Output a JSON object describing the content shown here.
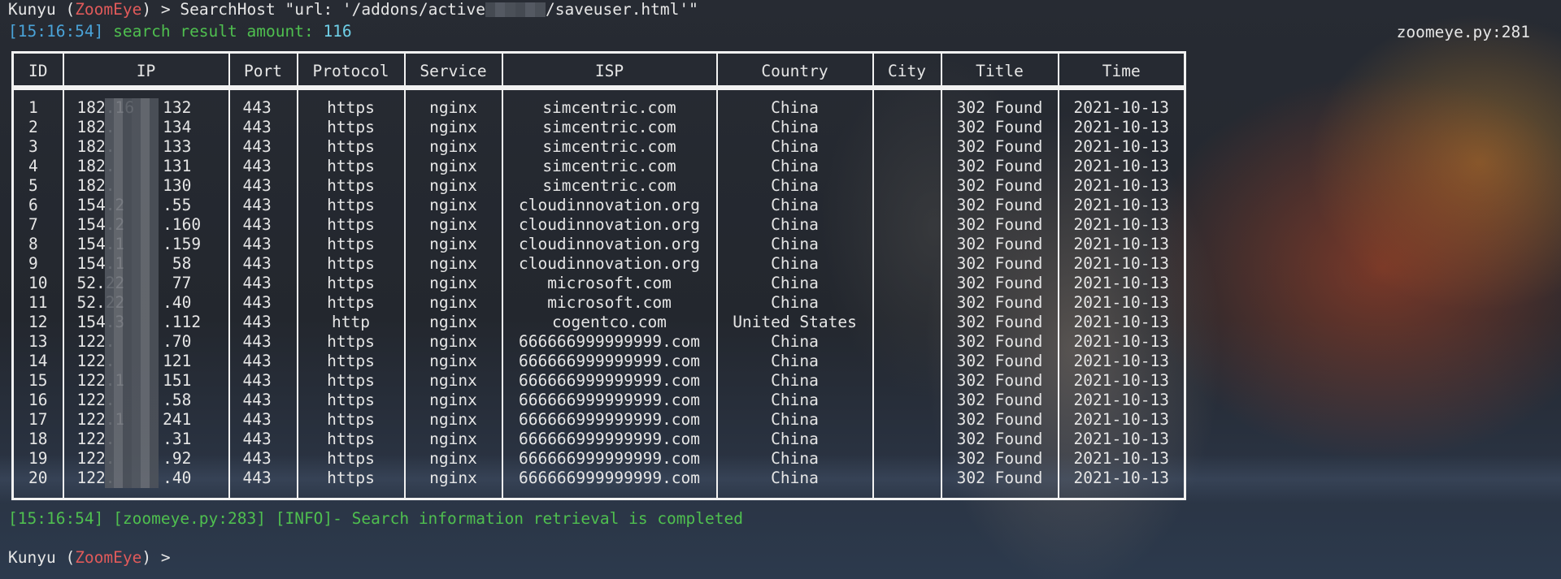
{
  "prompt_line": {
    "prompt_user": "Kunyu",
    "prompt_app": "ZoomEye",
    "command_before": " > SearchHost \"url: '/addons/active",
    "command_after": "/saveuser.html'\""
  },
  "result_line": {
    "timestamp": "[15:16:54]",
    "label": " search result amount: ",
    "amount": "116"
  },
  "source_tag": "zoomeye.py:281",
  "table": {
    "headers": [
      "ID",
      "IP",
      "Port",
      "Protocol",
      "Service",
      "ISP",
      "Country",
      "City",
      "Title",
      "Time"
    ],
    "rows": [
      [
        "1",
        "182.16   132",
        "443",
        "https",
        "nginx",
        "simcentric.com",
        "China",
        "",
        "302 Found",
        "2021-10-13"
      ],
      [
        "2",
        "182.     134",
        "443",
        "https",
        "nginx",
        "simcentric.com",
        "China",
        "",
        "302 Found",
        "2021-10-13"
      ],
      [
        "3",
        "182.     133",
        "443",
        "https",
        "nginx",
        "simcentric.com",
        "China",
        "",
        "302 Found",
        "2021-10-13"
      ],
      [
        "4",
        "182.     131",
        "443",
        "https",
        "nginx",
        "simcentric.com",
        "China",
        "",
        "302 Found",
        "2021-10-13"
      ],
      [
        "5",
        "182.     130",
        "443",
        "https",
        "nginx",
        "simcentric.com",
        "China",
        "",
        "302 Found",
        "2021-10-13"
      ],
      [
        "6",
        "154.2    .55",
        "443",
        "https",
        "nginx",
        "cloudinnovation.org",
        "China",
        "",
        "302 Found",
        "2021-10-13"
      ],
      [
        "7",
        "154.2    .160",
        "443",
        "https",
        "nginx",
        "cloudinnovation.org",
        "China",
        "",
        "302 Found",
        "2021-10-13"
      ],
      [
        "8",
        "154.1    .159",
        "443",
        "https",
        "nginx",
        "cloudinnovation.org",
        "China",
        "",
        "302 Found",
        "2021-10-13"
      ],
      [
        "9",
        "154.1     58",
        "443",
        "https",
        "nginx",
        "cloudinnovation.org",
        "China",
        "",
        "302 Found",
        "2021-10-13"
      ],
      [
        "10",
        "52.22     77",
        "443",
        "https",
        "nginx",
        "microsoft.com",
        "China",
        "",
        "302 Found",
        "2021-10-13"
      ],
      [
        "11",
        "52.22    .40",
        "443",
        "https",
        "nginx",
        "microsoft.com",
        "China",
        "",
        "302 Found",
        "2021-10-13"
      ],
      [
        "12",
        "154.3    .112",
        "443",
        "http",
        "nginx",
        "cogentco.com",
        "United States",
        "",
        "302 Found",
        "2021-10-13"
      ],
      [
        "13",
        "122.     .70",
        "443",
        "https",
        "nginx",
        "666666999999999.com",
        "China",
        "",
        "302 Found",
        "2021-10-13"
      ],
      [
        "14",
        "122.     121",
        "443",
        "https",
        "nginx",
        "666666999999999.com",
        "China",
        "",
        "302 Found",
        "2021-10-13"
      ],
      [
        "15",
        "122.1    151",
        "443",
        "https",
        "nginx",
        "666666999999999.com",
        "China",
        "",
        "302 Found",
        "2021-10-13"
      ],
      [
        "16",
        "122.     .58",
        "443",
        "https",
        "nginx",
        "666666999999999.com",
        "China",
        "",
        "302 Found",
        "2021-10-13"
      ],
      [
        "17",
        "122.1    241",
        "443",
        "https",
        "nginx",
        "666666999999999.com",
        "China",
        "",
        "302 Found",
        "2021-10-13"
      ],
      [
        "18",
        "122.     .31",
        "443",
        "https",
        "nginx",
        "666666999999999.com",
        "China",
        "",
        "302 Found",
        "2021-10-13"
      ],
      [
        "19",
        "122.     .92",
        "443",
        "https",
        "nginx",
        "666666999999999.com",
        "China",
        "",
        "302 Found",
        "2021-10-13"
      ],
      [
        "20",
        "122.     .40",
        "443",
        "https",
        "nginx",
        "666666999999999.com",
        "China",
        "",
        "302 Found",
        "2021-10-13"
      ]
    ]
  },
  "info_line": "[15:16:54] [zoomeye.py:283] [INFO]- Search information retrieval is completed",
  "final_prompt": {
    "prompt_user": "Kunyu",
    "prompt_app": "ZoomEye",
    "prompt_suffix": " >"
  },
  "colors": {
    "prompt_app": "#e05a5a",
    "timestamp": "#4aa3d8",
    "success_text": "#4fbf4f",
    "amount": "#6fd0e8",
    "table_border": "#f2f2f2"
  }
}
